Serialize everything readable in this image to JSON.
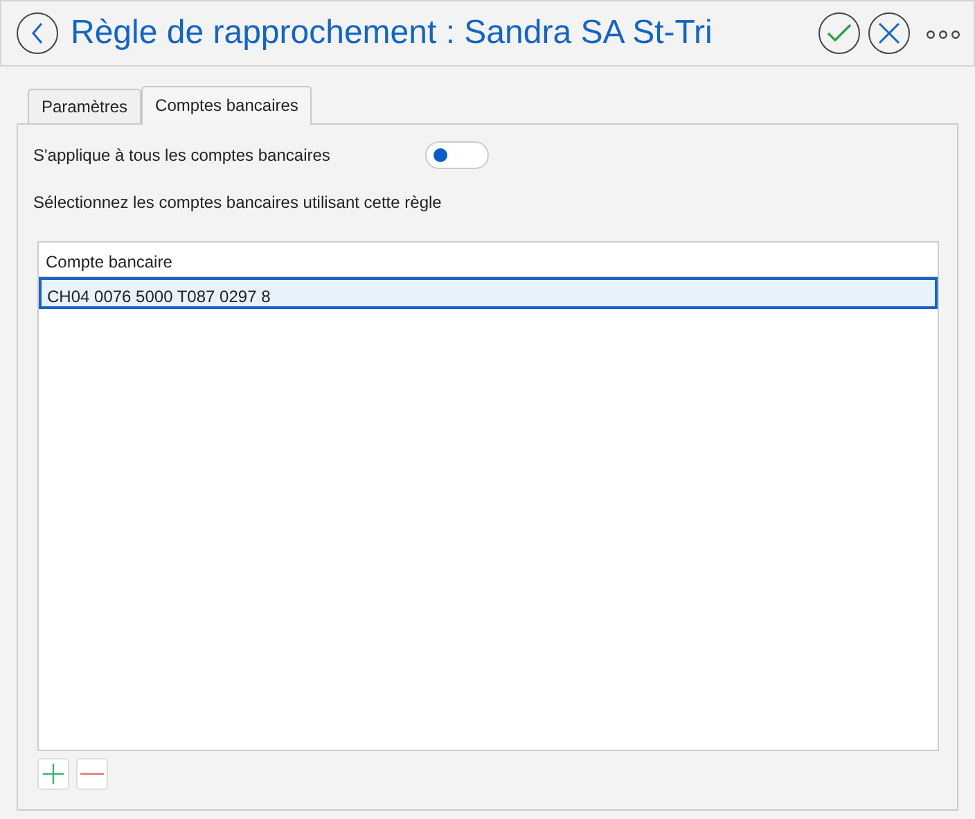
{
  "header": {
    "title": "Règle de rapprochement : Sandra SA St-Tri"
  },
  "tabs": [
    {
      "label": "Paramètres",
      "selected": false
    },
    {
      "label": "Comptes bancaires",
      "selected": true
    }
  ],
  "apply_all": {
    "label": "S'applique à tous les comptes bancaires",
    "on": false
  },
  "instruction": "Sélectionnez les comptes bancaires utilisant cette règle",
  "table": {
    "columns": [
      "Compte bancaire"
    ],
    "rows": [
      {
        "cells": [
          "CH04 0076 5000 T087 0297 8"
        ],
        "selected": true
      }
    ]
  }
}
